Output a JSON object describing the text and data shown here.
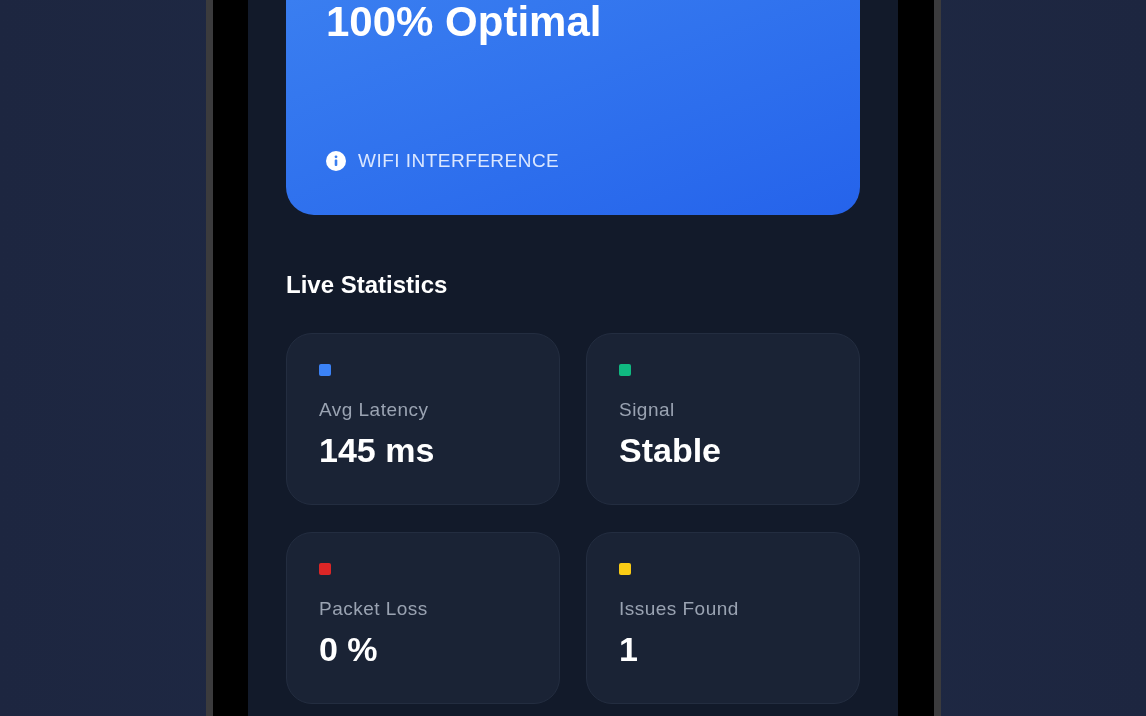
{
  "status_card": {
    "title": "100% Optimal",
    "note": "WIFI INTERFERENCE"
  },
  "live_statistics": {
    "heading": "Live Statistics",
    "stats": [
      {
        "label": "Avg Latency",
        "value": "145 ms",
        "color": "#3b82f6"
      },
      {
        "label": "Signal",
        "value": "Stable",
        "color": "#10b981"
      },
      {
        "label": "Packet Loss",
        "value": "0 %",
        "color": "#dc2626"
      },
      {
        "label": "Issues Found",
        "value": "1",
        "color": "#facc15"
      }
    ]
  }
}
